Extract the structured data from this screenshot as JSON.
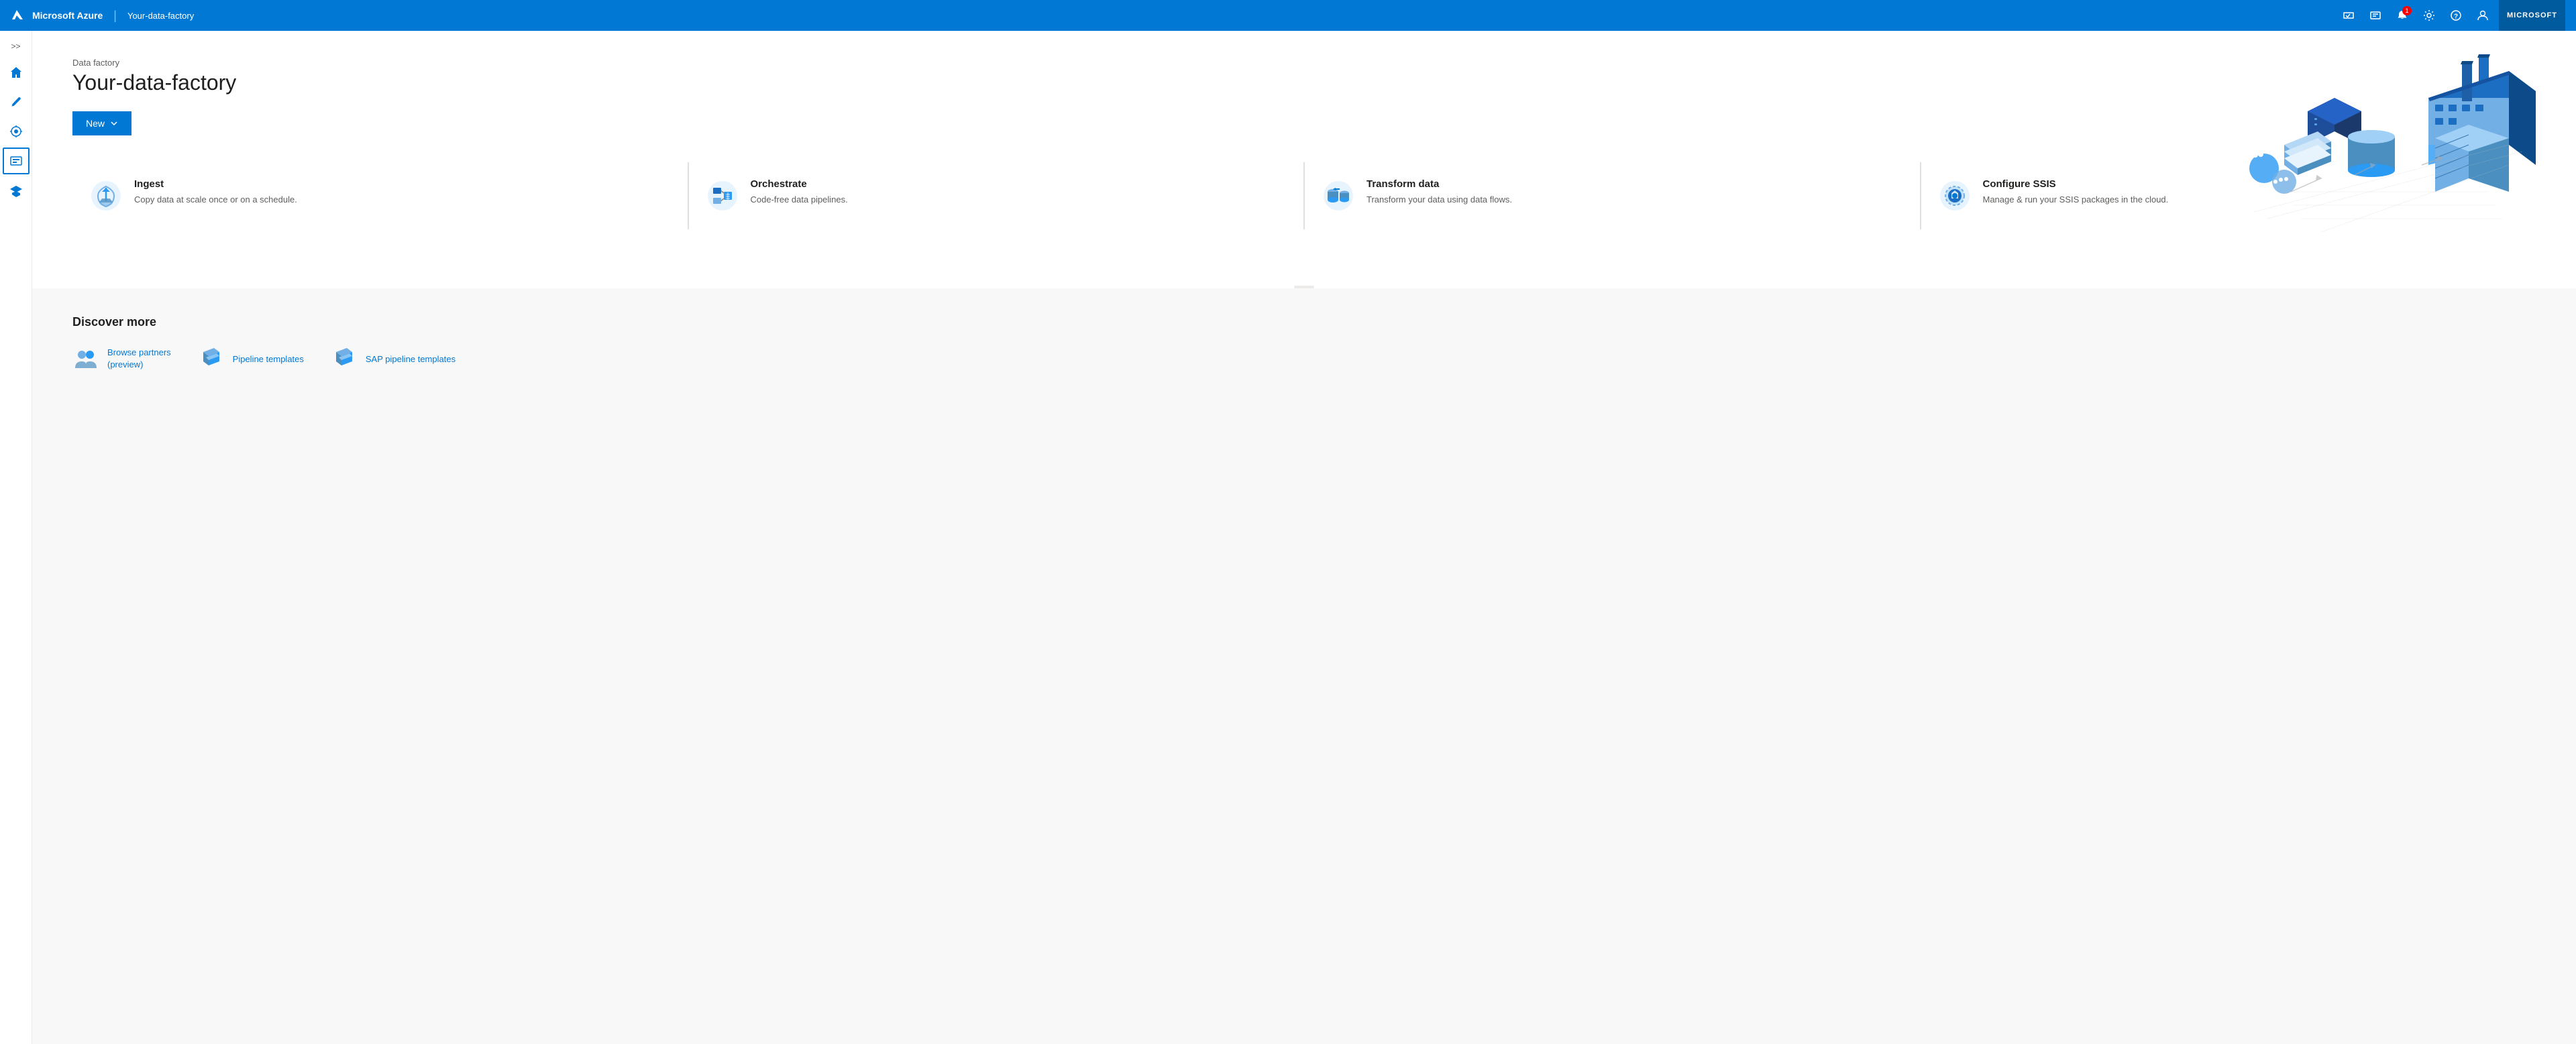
{
  "topbar": {
    "brand": "Microsoft Azure",
    "separator": "|",
    "factory_name": "Your-data-factory",
    "ms_label": "MICROSOFT",
    "notification_count": "1"
  },
  "sidebar": {
    "expand_label": ">>",
    "items": [
      {
        "id": "home",
        "label": "Home",
        "icon": "home-icon"
      },
      {
        "id": "author",
        "label": "Author",
        "icon": "pencil-icon"
      },
      {
        "id": "monitor",
        "label": "Monitor",
        "icon": "monitor-icon"
      },
      {
        "id": "manage",
        "label": "Manage",
        "icon": "briefcase-icon",
        "active": true
      },
      {
        "id": "learn",
        "label": "Learn",
        "icon": "learn-icon"
      }
    ]
  },
  "hero": {
    "label": "Data factory",
    "title": "Your-data-factory",
    "new_button": "New",
    "new_dropdown_icon": "chevron-down"
  },
  "feature_cards": [
    {
      "id": "ingest",
      "title": "Ingest",
      "description": "Copy data at scale once or on a schedule.",
      "icon": "ingest-icon"
    },
    {
      "id": "orchestrate",
      "title": "Orchestrate",
      "description": "Code-free data pipelines.",
      "icon": "orchestrate-icon"
    },
    {
      "id": "transform",
      "title": "Transform data",
      "description": "Transform your data using data flows.",
      "icon": "transform-icon"
    },
    {
      "id": "ssis",
      "title": "Configure SSIS",
      "description": "Manage & run your SSIS packages in the cloud.",
      "icon": "ssis-icon"
    }
  ],
  "discover": {
    "title": "Discover more",
    "items": [
      {
        "id": "partners",
        "label": "Browse partners\n(preview)",
        "icon": "partners-icon"
      },
      {
        "id": "pipeline-templates",
        "label": "Pipeline templates",
        "icon": "pipeline-templates-icon"
      },
      {
        "id": "sap-templates",
        "label": "SAP pipeline templates",
        "icon": "sap-templates-icon"
      }
    ]
  }
}
